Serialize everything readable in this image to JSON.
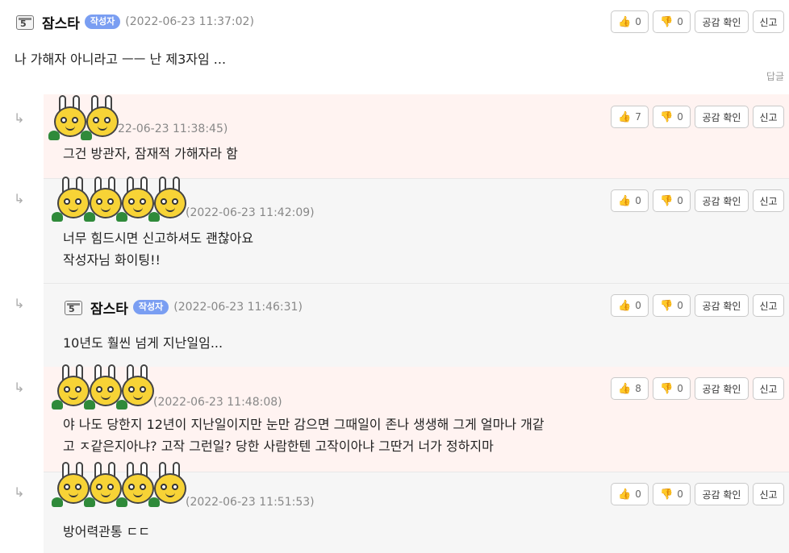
{
  "common": {
    "like_icon": "thumbs-up-icon",
    "dislike_icon": "thumbs-down-icon",
    "empathy_label": "공감 확인",
    "report_label": "신고",
    "reply_arrow": "↳",
    "level_number": "5"
  },
  "top_comment": {
    "nick": "잠스타",
    "badge": "작성자",
    "date": "(2022-06-23 11:37:02)",
    "likes": "0",
    "dislikes": "0",
    "text": "나 가해자 아니라고 ㅡㅡ 난 제3자임 ...",
    "reply_label": "답글"
  },
  "replies": [
    {
      "date": "22-06-23 11:38:45)",
      "likes": "7",
      "dislikes": "0",
      "lines": [
        "그건 방관자, 잠재적 가해자라 함"
      ]
    },
    {
      "date": "(2022-06-23 11:42:09)",
      "likes": "0",
      "dislikes": "0",
      "lines": [
        "너무 힘드시면 신고하셔도 괜찮아요",
        "작성자님 화이팅!!"
      ]
    },
    {
      "nick": "잠스타",
      "badge": "작성자",
      "date": "(2022-06-23 11:46:31)",
      "likes": "0",
      "dislikes": "0",
      "lines": [
        "10년도 훨씬 넘게 지난일임..."
      ]
    },
    {
      "date": "(2022-06-23 11:48:08)",
      "likes": "8",
      "dislikes": "0",
      "lines": [
        "야 나도 당한지 12년이 지난일이지만 눈만 감으면 그때일이 존나 생생해 그게 얼마나 개같",
        "고 ㅈ같은지아냐? 고작 그런일? 당한 사람한텐 고작이아냐 그딴거 너가 정하지마"
      ]
    },
    {
      "date": "(2022-06-23 11:51:53)",
      "likes": "0",
      "dislikes": "0",
      "lines": [
        "방어력관통 ㄷㄷ"
      ]
    }
  ]
}
